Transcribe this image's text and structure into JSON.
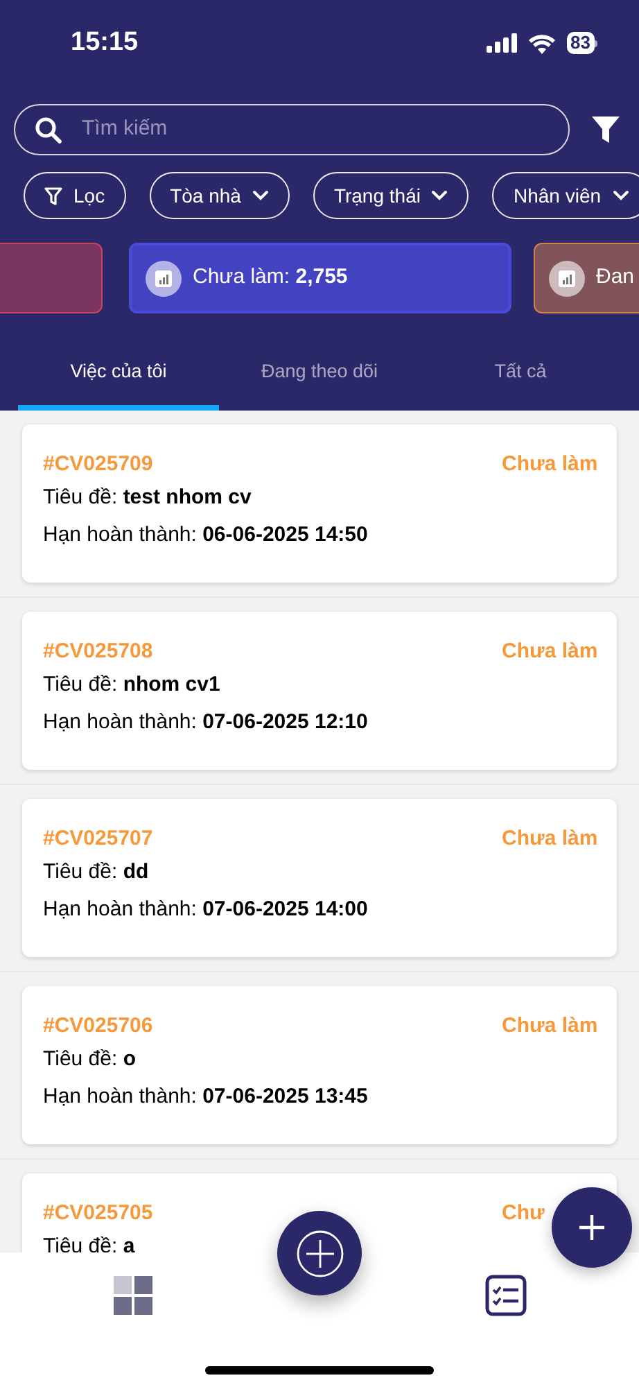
{
  "status_bar": {
    "time": "15:15",
    "battery": "83"
  },
  "search": {
    "placeholder": "Tìm kiếm"
  },
  "filters": [
    {
      "kind": "filter",
      "label": "Lọc"
    },
    {
      "kind": "dropdown",
      "label": "Tòa nhà"
    },
    {
      "kind": "dropdown",
      "label": "Trạng thái"
    },
    {
      "kind": "dropdown",
      "label": "Nhân viên"
    }
  ],
  "summary_cards": [
    {
      "color": "#c9445a",
      "selected": false
    },
    {
      "color": "#4a4ad8",
      "selected": true,
      "label": "Chưa làm: ",
      "count": "2,755"
    },
    {
      "color": "#d5804a",
      "selected": false,
      "label": "Đan"
    }
  ],
  "tabs": [
    {
      "label": "Việc của tôi",
      "selected": true
    },
    {
      "label": "Đang theo dõi",
      "selected": false
    },
    {
      "label": "Tất cả",
      "selected": false
    }
  ],
  "tasks": [
    {
      "code": "#CV025709",
      "status": "Chưa làm",
      "title_label": "Tiêu đề: ",
      "title": "test nhom cv",
      "due_label": "Hạn hoàn thành: ",
      "due": "06-06-2025 14:50"
    },
    {
      "code": "#CV025708",
      "status": "Chưa làm",
      "title_label": "Tiêu đề: ",
      "title": "nhom cv1",
      "due_label": "Hạn hoàn thành: ",
      "due": "07-06-2025 12:10"
    },
    {
      "code": "#CV025707",
      "status": "Chưa làm",
      "title_label": "Tiêu đề: ",
      "title": "dd",
      "due_label": "Hạn hoàn thành: ",
      "due": "07-06-2025 14:00"
    },
    {
      "code": "#CV025706",
      "status": "Chưa làm",
      "title_label": "Tiêu đề: ",
      "title": "o",
      "due_label": "Hạn hoàn thành: ",
      "due": "07-06-2025 13:45"
    },
    {
      "code": "#CV025705",
      "status": "Chư",
      "title_label": "Tiêu đề: ",
      "title": "a"
    }
  ],
  "bottom_nav": [
    {
      "kind": "dashboard",
      "selected": false
    },
    {
      "kind": "tasks",
      "selected": true
    }
  ]
}
